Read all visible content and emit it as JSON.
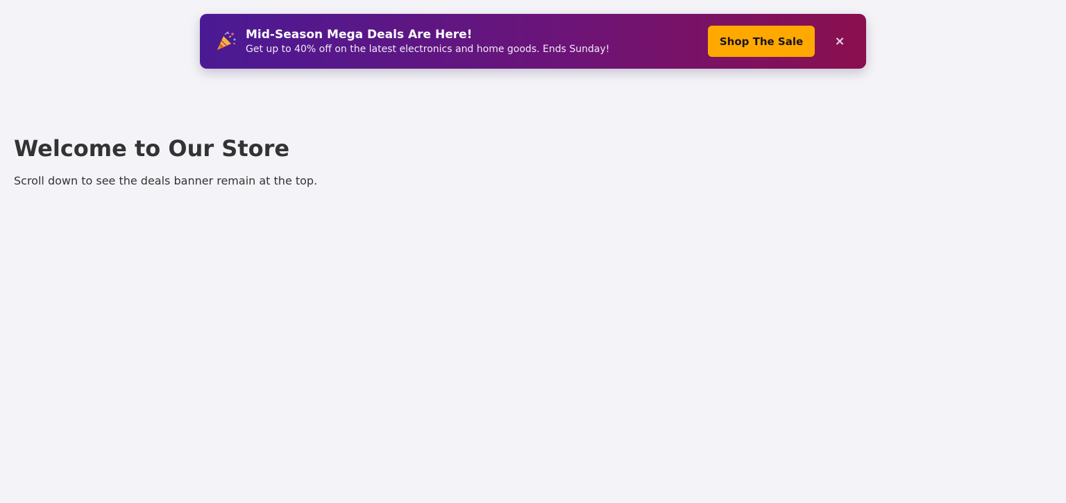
{
  "banner": {
    "icon": "party-popper-icon",
    "title": "Mid-Season Mega Deals Are Here!",
    "subtitle": "Get up to 40% off on the latest electronics and home goods. Ends Sunday!",
    "cta_label": "Shop The Sale",
    "close_label": "×",
    "colors": {
      "gradient_start": "#4a1a94",
      "gradient_end": "#8a0f4e",
      "cta_background": "#ffa900"
    }
  },
  "main": {
    "title": "Welcome to Our Store",
    "text": "Scroll down to see the deals banner remain at the top."
  },
  "colors": {
    "page_background": "#f4f4f8",
    "text": "#333333"
  }
}
